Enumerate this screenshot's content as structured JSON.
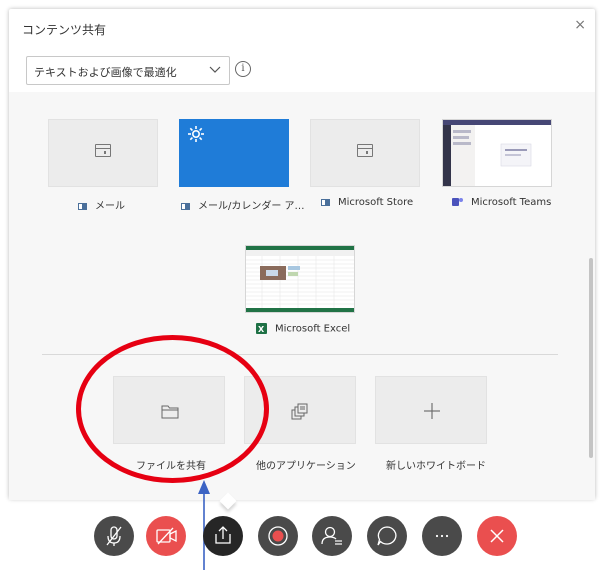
{
  "dialog": {
    "title": "コンテンツ共有",
    "close": "×",
    "optimize_dropdown": {
      "value": "テキストおよび画像で最適化"
    },
    "info": "i"
  },
  "windows": [
    {
      "label": "メール",
      "icon": "mail-app-icon"
    },
    {
      "label": "メール/カレンダー ア…",
      "icon": "calendar-app-icon",
      "thumbnail": "blue-with-gear"
    },
    {
      "label": "Microsoft Store",
      "icon": "store-app-icon"
    },
    {
      "label": "Microsoft Teams",
      "icon": "teams-app-icon",
      "thumbnail": "teams-screenshot"
    },
    {
      "label": "Microsoft Excel",
      "icon": "excel-app-icon",
      "thumbnail": "excel-screenshot"
    }
  ],
  "actions": [
    {
      "label": "ファイルを共有",
      "icon": "folder-icon"
    },
    {
      "label": "他のアプリケーション",
      "icon": "app-stack-icon"
    },
    {
      "label": "新しいホワイトボード",
      "icon": "plus-icon"
    }
  ],
  "call_controls": [
    {
      "name": "mute-microphone",
      "icon": "microphone-off-icon",
      "color": "#4a4a4a"
    },
    {
      "name": "camera-off",
      "icon": "camera-off-icon",
      "color": "#ea4f4f"
    },
    {
      "name": "share",
      "icon": "share-icon",
      "color": "#262626"
    },
    {
      "name": "record",
      "icon": "record-icon",
      "color": "#4a4a4a"
    },
    {
      "name": "participants",
      "icon": "participants-icon",
      "color": "#4a4a4a"
    },
    {
      "name": "chat",
      "icon": "chat-icon",
      "color": "#4a4a4a"
    },
    {
      "name": "more",
      "icon": "more-icon",
      "color": "#4a4a4a"
    },
    {
      "name": "leave",
      "icon": "close-icon",
      "color": "#ea4f4f"
    }
  ],
  "annotation": {
    "highlight_color": "#e60012",
    "arrow_color": "#3b63c4"
  }
}
